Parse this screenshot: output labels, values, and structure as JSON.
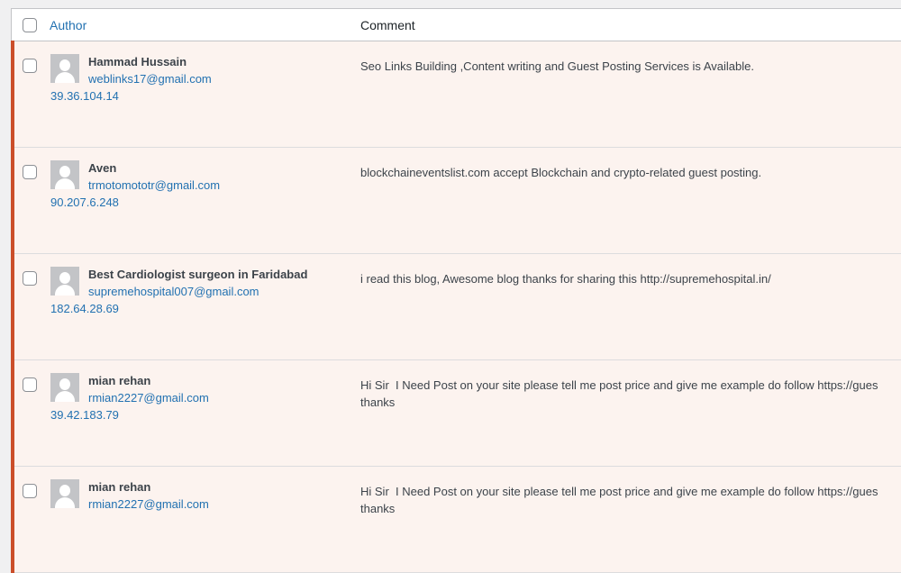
{
  "table": {
    "columns": {
      "author": "Author",
      "comment": "Comment"
    },
    "colors": {
      "pending_border": "#cb4e2a",
      "pending_background": "#fcf3ef",
      "link": "#2271b1"
    },
    "rows": [
      {
        "name": "Hammad Hussain",
        "email": "weblinks17@gmail.com",
        "ip": "39.36.104.14",
        "comment": "Seo Links Building ,Content writing and Guest Posting Services is Available."
      },
      {
        "name": "Aven",
        "email": "trmotomototr@gmail.com",
        "ip": "90.207.6.248",
        "comment": "blockchaineventslist.com accept Blockchain and crypto-related guest posting."
      },
      {
        "name": "Best Cardiologist surgeon in Faridabad",
        "email": "supremehospital007@gmail.com",
        "ip": "182.64.28.69",
        "comment": "i read this blog, Awesome blog thanks for sharing this http://supremehospital.in/"
      },
      {
        "name": "mian rehan",
        "email": "rmian2227@gmail.com",
        "ip": "39.42.183.79",
        "comment": "Hi Sir  I Need Post on your site please tell me post price and give me example do follow https://gues\nthanks"
      },
      {
        "name": "mian rehan",
        "email": "rmian2227@gmail.com",
        "ip": "",
        "comment": "Hi Sir  I Need Post on your site please tell me post price and give me example do follow https://gues\nthanks"
      }
    ]
  }
}
